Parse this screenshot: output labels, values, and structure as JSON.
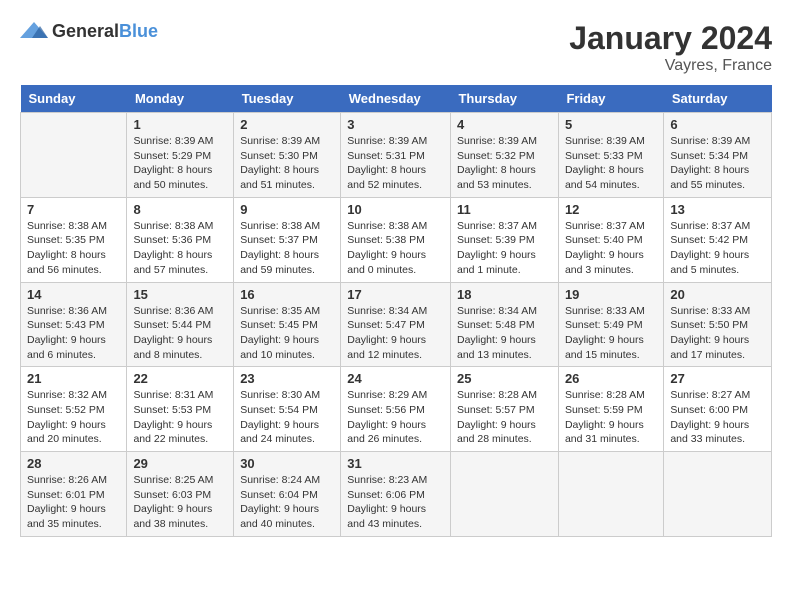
{
  "logo": {
    "general": "General",
    "blue": "Blue"
  },
  "header": {
    "month": "January 2024",
    "location": "Vayres, France"
  },
  "weekdays": [
    "Sunday",
    "Monday",
    "Tuesday",
    "Wednesday",
    "Thursday",
    "Friday",
    "Saturday"
  ],
  "weeks": [
    [
      {
        "day": "",
        "sunrise": "",
        "sunset": "",
        "daylight": ""
      },
      {
        "day": "1",
        "sunrise": "Sunrise: 8:39 AM",
        "sunset": "Sunset: 5:29 PM",
        "daylight": "Daylight: 8 hours and 50 minutes."
      },
      {
        "day": "2",
        "sunrise": "Sunrise: 8:39 AM",
        "sunset": "Sunset: 5:30 PM",
        "daylight": "Daylight: 8 hours and 51 minutes."
      },
      {
        "day": "3",
        "sunrise": "Sunrise: 8:39 AM",
        "sunset": "Sunset: 5:31 PM",
        "daylight": "Daylight: 8 hours and 52 minutes."
      },
      {
        "day": "4",
        "sunrise": "Sunrise: 8:39 AM",
        "sunset": "Sunset: 5:32 PM",
        "daylight": "Daylight: 8 hours and 53 minutes."
      },
      {
        "day": "5",
        "sunrise": "Sunrise: 8:39 AM",
        "sunset": "Sunset: 5:33 PM",
        "daylight": "Daylight: 8 hours and 54 minutes."
      },
      {
        "day": "6",
        "sunrise": "Sunrise: 8:39 AM",
        "sunset": "Sunset: 5:34 PM",
        "daylight": "Daylight: 8 hours and 55 minutes."
      }
    ],
    [
      {
        "day": "7",
        "sunrise": "Sunrise: 8:38 AM",
        "sunset": "Sunset: 5:35 PM",
        "daylight": "Daylight: 8 hours and 56 minutes."
      },
      {
        "day": "8",
        "sunrise": "Sunrise: 8:38 AM",
        "sunset": "Sunset: 5:36 PM",
        "daylight": "Daylight: 8 hours and 57 minutes."
      },
      {
        "day": "9",
        "sunrise": "Sunrise: 8:38 AM",
        "sunset": "Sunset: 5:37 PM",
        "daylight": "Daylight: 8 hours and 59 minutes."
      },
      {
        "day": "10",
        "sunrise": "Sunrise: 8:38 AM",
        "sunset": "Sunset: 5:38 PM",
        "daylight": "Daylight: 9 hours and 0 minutes."
      },
      {
        "day": "11",
        "sunrise": "Sunrise: 8:37 AM",
        "sunset": "Sunset: 5:39 PM",
        "daylight": "Daylight: 9 hours and 1 minute."
      },
      {
        "day": "12",
        "sunrise": "Sunrise: 8:37 AM",
        "sunset": "Sunset: 5:40 PM",
        "daylight": "Daylight: 9 hours and 3 minutes."
      },
      {
        "day": "13",
        "sunrise": "Sunrise: 8:37 AM",
        "sunset": "Sunset: 5:42 PM",
        "daylight": "Daylight: 9 hours and 5 minutes."
      }
    ],
    [
      {
        "day": "14",
        "sunrise": "Sunrise: 8:36 AM",
        "sunset": "Sunset: 5:43 PM",
        "daylight": "Daylight: 9 hours and 6 minutes."
      },
      {
        "day": "15",
        "sunrise": "Sunrise: 8:36 AM",
        "sunset": "Sunset: 5:44 PM",
        "daylight": "Daylight: 9 hours and 8 minutes."
      },
      {
        "day": "16",
        "sunrise": "Sunrise: 8:35 AM",
        "sunset": "Sunset: 5:45 PM",
        "daylight": "Daylight: 9 hours and 10 minutes."
      },
      {
        "day": "17",
        "sunrise": "Sunrise: 8:34 AM",
        "sunset": "Sunset: 5:47 PM",
        "daylight": "Daylight: 9 hours and 12 minutes."
      },
      {
        "day": "18",
        "sunrise": "Sunrise: 8:34 AM",
        "sunset": "Sunset: 5:48 PM",
        "daylight": "Daylight: 9 hours and 13 minutes."
      },
      {
        "day": "19",
        "sunrise": "Sunrise: 8:33 AM",
        "sunset": "Sunset: 5:49 PM",
        "daylight": "Daylight: 9 hours and 15 minutes."
      },
      {
        "day": "20",
        "sunrise": "Sunrise: 8:33 AM",
        "sunset": "Sunset: 5:50 PM",
        "daylight": "Daylight: 9 hours and 17 minutes."
      }
    ],
    [
      {
        "day": "21",
        "sunrise": "Sunrise: 8:32 AM",
        "sunset": "Sunset: 5:52 PM",
        "daylight": "Daylight: 9 hours and 20 minutes."
      },
      {
        "day": "22",
        "sunrise": "Sunrise: 8:31 AM",
        "sunset": "Sunset: 5:53 PM",
        "daylight": "Daylight: 9 hours and 22 minutes."
      },
      {
        "day": "23",
        "sunrise": "Sunrise: 8:30 AM",
        "sunset": "Sunset: 5:54 PM",
        "daylight": "Daylight: 9 hours and 24 minutes."
      },
      {
        "day": "24",
        "sunrise": "Sunrise: 8:29 AM",
        "sunset": "Sunset: 5:56 PM",
        "daylight": "Daylight: 9 hours and 26 minutes."
      },
      {
        "day": "25",
        "sunrise": "Sunrise: 8:28 AM",
        "sunset": "Sunset: 5:57 PM",
        "daylight": "Daylight: 9 hours and 28 minutes."
      },
      {
        "day": "26",
        "sunrise": "Sunrise: 8:28 AM",
        "sunset": "Sunset: 5:59 PM",
        "daylight": "Daylight: 9 hours and 31 minutes."
      },
      {
        "day": "27",
        "sunrise": "Sunrise: 8:27 AM",
        "sunset": "Sunset: 6:00 PM",
        "daylight": "Daylight: 9 hours and 33 minutes."
      }
    ],
    [
      {
        "day": "28",
        "sunrise": "Sunrise: 8:26 AM",
        "sunset": "Sunset: 6:01 PM",
        "daylight": "Daylight: 9 hours and 35 minutes."
      },
      {
        "day": "29",
        "sunrise": "Sunrise: 8:25 AM",
        "sunset": "Sunset: 6:03 PM",
        "daylight": "Daylight: 9 hours and 38 minutes."
      },
      {
        "day": "30",
        "sunrise": "Sunrise: 8:24 AM",
        "sunset": "Sunset: 6:04 PM",
        "daylight": "Daylight: 9 hours and 40 minutes."
      },
      {
        "day": "31",
        "sunrise": "Sunrise: 8:23 AM",
        "sunset": "Sunset: 6:06 PM",
        "daylight": "Daylight: 9 hours and 43 minutes."
      },
      {
        "day": "",
        "sunrise": "",
        "sunset": "",
        "daylight": ""
      },
      {
        "day": "",
        "sunrise": "",
        "sunset": "",
        "daylight": ""
      },
      {
        "day": "",
        "sunrise": "",
        "sunset": "",
        "daylight": ""
      }
    ]
  ]
}
